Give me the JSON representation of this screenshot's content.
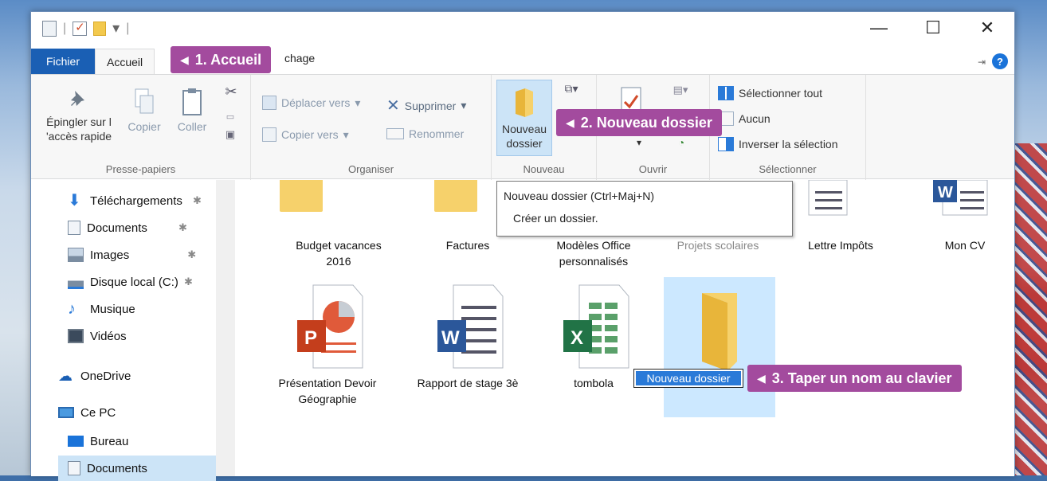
{
  "titlebar": {
    "separator": "|",
    "dropdown": "▾",
    "minimize": "—",
    "maximize": "☐",
    "close": "✕"
  },
  "tabs": {
    "file": "Fichier",
    "home": "Accueil",
    "share": "chage",
    "help": "?"
  },
  "ribbon": {
    "pin_label": "Épingler sur l 'accès rapide",
    "copy_label": "Copier",
    "paste_label": "Coller",
    "clipboard_group": "Presse-papiers",
    "move_to": "Déplacer vers",
    "copy_to": "Copier vers",
    "delete": "Supprimer",
    "rename": "Renommer",
    "organize_group": "Organiser",
    "new_folder": "Nouveau dossier",
    "new_group": "Nouveau",
    "open_group": "Ouvrir",
    "select_all": "Sélectionner tout",
    "select_none": "Aucun",
    "invert_selection": "Inverser la sélection",
    "select_group": "Sélectionner"
  },
  "sidebar": {
    "items": [
      {
        "label": "Téléchargements",
        "pinned": true
      },
      {
        "label": "Documents",
        "pinned": true
      },
      {
        "label": "Images",
        "pinned": true
      },
      {
        "label": "Disque local (C:)",
        "pinned": true
      },
      {
        "label": "Musique",
        "pinned": false
      },
      {
        "label": "Vidéos",
        "pinned": false
      },
      {
        "label": "OneDrive",
        "pinned": false
      },
      {
        "label": "Ce PC",
        "pinned": false
      },
      {
        "label": "Bureau",
        "pinned": false
      },
      {
        "label": "Documents",
        "pinned": false
      }
    ]
  },
  "files": {
    "row1": [
      "Budget vacances 2016",
      "Factures",
      "Modèles Office personnalisés",
      "Projets scolaires",
      "Lettre Impôts",
      "Mon CV"
    ],
    "row2": [
      "Présentation Devoir Géographie",
      "Rapport de stage 3è",
      "tombola"
    ],
    "new_folder_name": "Nouveau dossier"
  },
  "tooltip": {
    "title": "Nouveau dossier (Ctrl+Maj+N)",
    "body": "Créer un dossier."
  },
  "callouts": {
    "step1": "1. Accueil",
    "step2": "2. Nouveau dossier",
    "step3": "3. Taper un nom au clavier",
    "arrow": "◀"
  },
  "colors": {
    "accent": "#1a5fb4",
    "callout": "#a34b9e",
    "folder": "#f6d16b",
    "selection": "#cce8ff"
  }
}
